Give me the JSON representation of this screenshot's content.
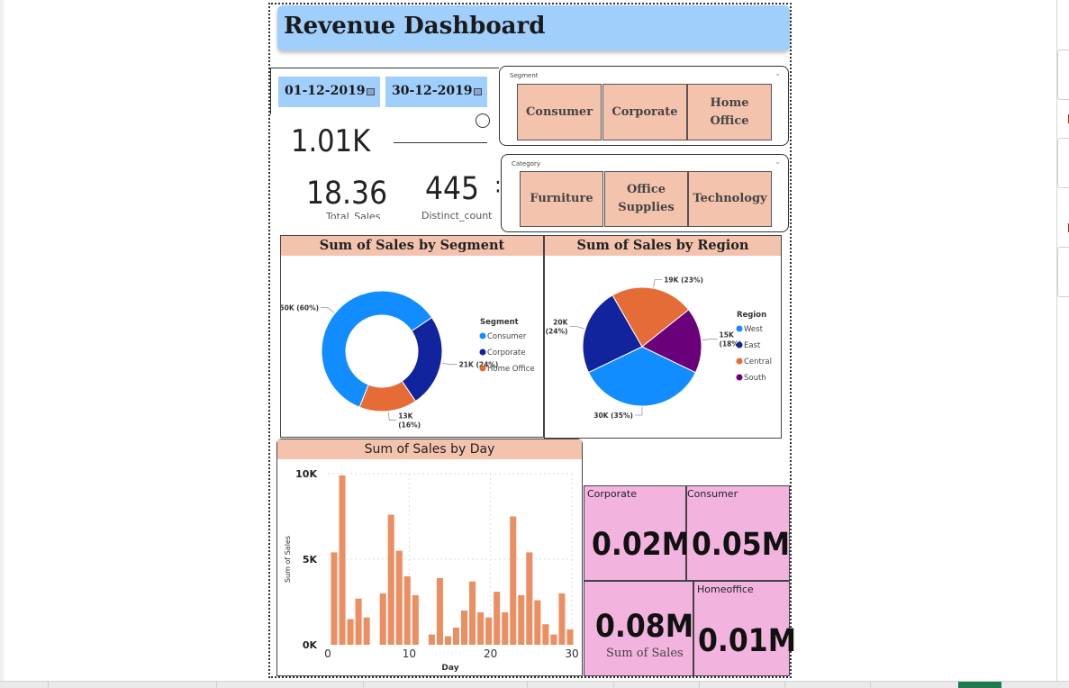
{
  "dashboard": {
    "title": "Revenue Dashboard"
  },
  "dates": {
    "start": "01-12-2019",
    "end": "30-12-2019"
  },
  "kpis": {
    "top_value": "1.01K",
    "total_sales": {
      "value": "18.36",
      "label": "Total_Sales"
    },
    "distinct": {
      "value": "445",
      "label": "Distinct_count"
    }
  },
  "segment_slicer": {
    "title": "Segment",
    "options": [
      "Consumer",
      "Corporate",
      "Home Office"
    ]
  },
  "category_slicer": {
    "title": "Category",
    "options": [
      "Furniture",
      "Office Supplies",
      "Technology"
    ]
  },
  "cards": [
    {
      "label": "Corporate",
      "value": "0.02M"
    },
    {
      "label": "Consumer",
      "value": "0.05M"
    },
    {
      "label": "",
      "value": "0.08M",
      "sub": "Sum of Sales"
    },
    {
      "label": "Homeoffice",
      "value": "0.01M"
    }
  ],
  "colors": {
    "title_bg": "#a0cffc",
    "panel_header": "#f4c3ae",
    "card_bg": "#f2b3de",
    "bar": "#eb8f63",
    "consumer": "#118dff",
    "corporate": "#12239e",
    "home_office": "#e66c37",
    "west": "#118dff",
    "east": "#12239e",
    "central": "#e66c37",
    "south": "#6b007b"
  },
  "chart_data": [
    {
      "type": "pie",
      "variant": "donut",
      "title": "Sum of Sales by Segment",
      "legend_title": "Segment",
      "legend_position": "right",
      "categories": [
        "Consumer",
        "Corporate",
        "Home Office"
      ],
      "values": [
        50,
        21,
        13
      ],
      "value_unit": "K",
      "labels": [
        "50K (60%)",
        "21K (24%)",
        "13K (16%)"
      ]
    },
    {
      "type": "pie",
      "title": "Sum of Sales by Region",
      "legend_title": "Region",
      "legend_position": "right",
      "categories": [
        "West",
        "East",
        "Central",
        "South"
      ],
      "values": [
        30,
        20,
        19,
        15
      ],
      "value_unit": "K",
      "labels": [
        "30K (35%)",
        "20K (24%)",
        "19K (23%)",
        "15K (18%)"
      ]
    },
    {
      "type": "bar",
      "title": "Sum of Sales by Day",
      "xlabel": "Day",
      "ylabel": "Sum of Sales",
      "x": [
        1,
        2,
        3,
        4,
        5,
        6,
        7,
        8,
        9,
        10,
        11,
        12,
        13,
        14,
        15,
        16,
        17,
        18,
        19,
        20,
        21,
        22,
        23,
        24,
        25,
        26,
        27,
        28,
        29,
        30
      ],
      "values": [
        5400,
        9900,
        1500,
        2700,
        1600,
        0,
        3000,
        7600,
        5500,
        4000,
        2900,
        0,
        600,
        3900,
        500,
        1000,
        2000,
        3700,
        1900,
        1600,
        3100,
        1900,
        7500,
        2900,
        5400,
        2600,
        1200,
        600,
        3000,
        900
      ],
      "xticks": [
        0,
        10,
        20,
        30
      ],
      "yticks": [
        "0K",
        "5K",
        "10K"
      ],
      "ylim": [
        0,
        10000
      ],
      "grid": true
    }
  ]
}
